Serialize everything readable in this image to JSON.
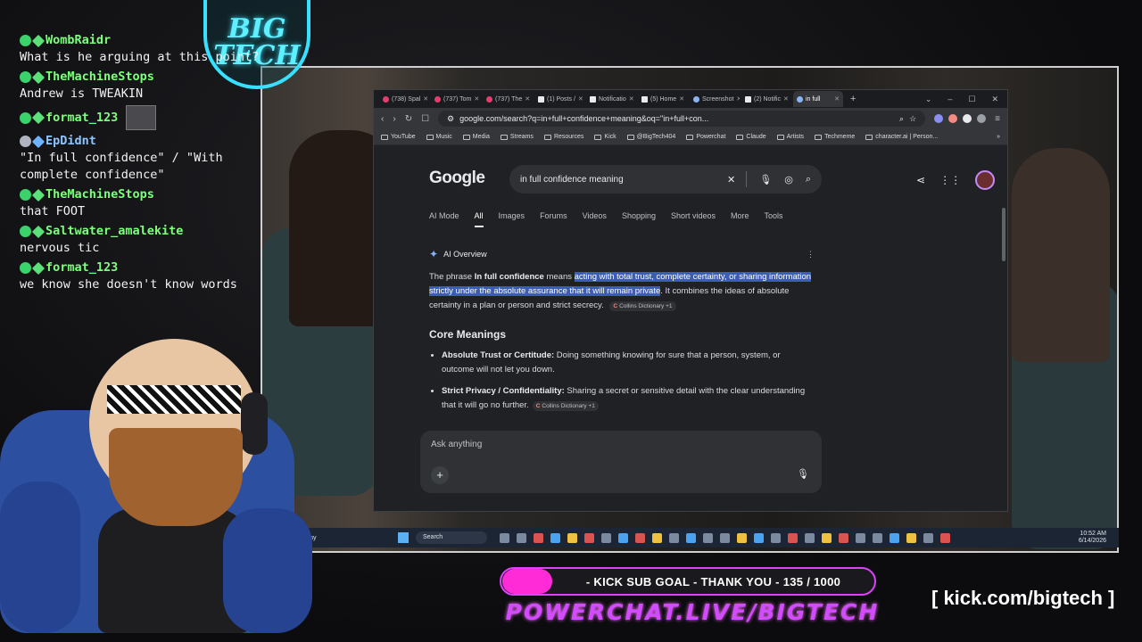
{
  "chat": [
    {
      "user": "WombRaidr",
      "text": "What is he arguing at this point?",
      "emote": false,
      "blue": false
    },
    {
      "user": "TheMachineStops",
      "text": "Andrew is TWEAKIN",
      "emote": false,
      "blue": false
    },
    {
      "user": "format_123",
      "text": "",
      "emote": true,
      "blue": false
    },
    {
      "user": "EpDidnt",
      "text": "\"In full confidence\" / \"With complete confidence\"",
      "emote": false,
      "blue": true
    },
    {
      "user": "TheMachineStops",
      "text": "that FOOT",
      "emote": false,
      "blue": false
    },
    {
      "user": "Saltwater_amalekite",
      "text": "nervous tic",
      "emote": false,
      "blue": false
    },
    {
      "user": "format_123",
      "text": "we know she doesn't know words",
      "emote": false,
      "blue": false
    }
  ],
  "logo_text": "BIG TECH",
  "browser": {
    "tabs": [
      {
        "label": "(738) Spal",
        "icon": "youtube-icon"
      },
      {
        "label": "(737) Tom",
        "icon": "youtube-icon"
      },
      {
        "label": "(737) The",
        "icon": "youtube-icon"
      },
      {
        "label": "(1) Posts /",
        "icon": "x-icon"
      },
      {
        "label": "Notificatio",
        "icon": "x-icon"
      },
      {
        "label": "(5) Home",
        "icon": "x-icon"
      },
      {
        "label": "Screenshot",
        "icon": "globe-icon"
      },
      {
        "label": "(2) Notific",
        "icon": "x-icon"
      },
      {
        "label": "in full",
        "icon": "google-icon",
        "active": true
      }
    ],
    "url": "google.com/search?q=in+full+confidence+meaning&oq=\"in+full+con...",
    "bookmarks": [
      "YouTube",
      "Music",
      "Media",
      "Streams",
      "Resources",
      "Kick",
      "@BigTech404",
      "Powerchat",
      "Claude",
      "Artists",
      "Techmeme",
      "character.ai | Person..."
    ]
  },
  "google": {
    "logo": "Google",
    "query": "in full confidence meaning",
    "tabs": [
      "AI Mode",
      "All",
      "Images",
      "Forums",
      "Videos",
      "Shopping",
      "Short videos",
      "More",
      "Tools"
    ],
    "active_tab": "All",
    "ai_overview_label": "AI Overview",
    "summary_prefix": "The phrase ",
    "summary_term": "In full confidence",
    "summary_means": " means ",
    "summary_highlight": "acting with total trust, complete certainty, or sharing information strictly under the absolute assurance that it will remain private",
    "summary_rest": ". It combines the ideas of absolute certainty in a plan or person and strict secrecy.",
    "source_chip": "Collins Dictionary +1",
    "core_heading": "Core Meanings",
    "bullets": [
      {
        "title": "Absolute Trust or Certitude:",
        "text": " Doing something knowing for sure that a person, system, or outcome will not let you down."
      },
      {
        "title": "Strict Privacy / Confidentiality:",
        "text": " Sharing a secret or sensitive detail with the clear understanding that it will go no further."
      }
    ],
    "ask_placeholder": "Ask anything"
  },
  "taskbar": {
    "search": "Search",
    "weather": "Partly sunny",
    "time": "10:52 AM",
    "date": "6/14/2026"
  },
  "sub_goal": {
    "label": "- KICK SUB GOAL - THANK YOU - 135 / 1000",
    "current": 135,
    "target": 1000
  },
  "powerchat_url": "POWERCHAT.LIVE/BIGTECH",
  "kick_url": "[ kick.com/bigtech ]"
}
